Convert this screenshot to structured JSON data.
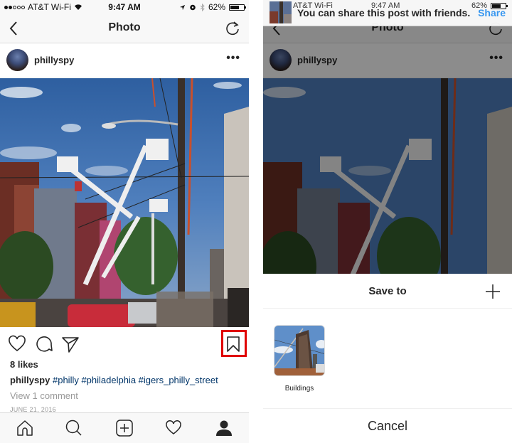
{
  "status_bar": {
    "carrier": "AT&T Wi-Fi",
    "time": "9:47 AM",
    "battery": "62%",
    "battery_level": 0.62,
    "signal_bars_filled": 2,
    "signal_bars_total": 5
  },
  "nav": {
    "title": "Photo",
    "back_icon": "chevron-left-icon",
    "refresh_icon": "refresh-icon"
  },
  "post": {
    "username": "phillyspy",
    "more_label": "•••",
    "likes": "8 likes",
    "caption_user": "phillyspy",
    "caption_tags": "#philly #philadelphia #igers_philly_street",
    "view_comments": "View 1 comment",
    "date": "JUNE 21, 2016"
  },
  "actions": {
    "icons": [
      "heart-icon",
      "comment-icon",
      "send-icon",
      "bookmark-icon"
    ]
  },
  "tabbar": {
    "icons": [
      "home-icon",
      "search-icon",
      "add-post-icon",
      "activity-heart-icon",
      "profile-icon"
    ]
  },
  "banner": {
    "message": "You can share this post with friends.",
    "share_label": "Share"
  },
  "save_sheet": {
    "title": "Save to",
    "collections": [
      {
        "label": "Buildings"
      }
    ],
    "cancel_label": "Cancel"
  },
  "colors": {
    "hashtag": "#003569",
    "share_link": "#3897f0",
    "highlight": "#e00000"
  }
}
